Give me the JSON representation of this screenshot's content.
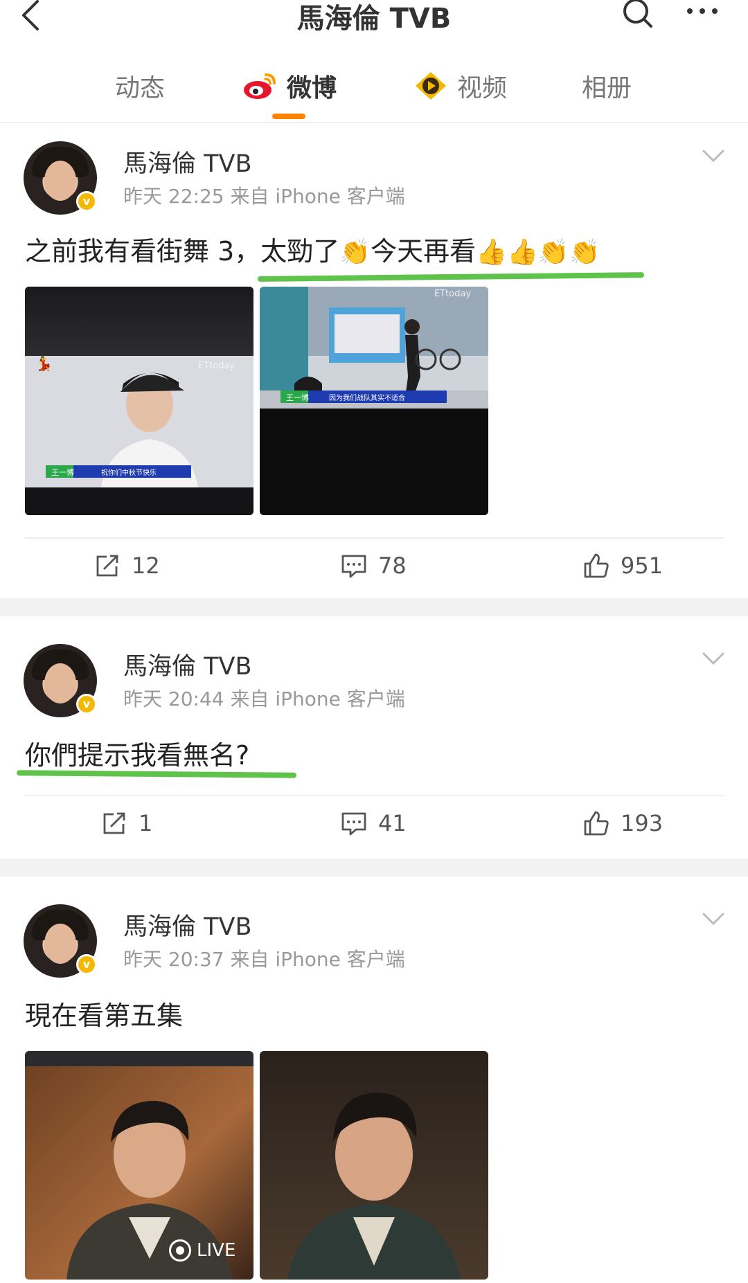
{
  "header": {
    "title": "馬海倫 TVB",
    "back_icon": "chevron-left-icon",
    "search_icon": "search-icon",
    "more_icon": "more-icon"
  },
  "tabs": [
    {
      "label": "动态",
      "icon": null,
      "active": false
    },
    {
      "label": "微博",
      "icon": "weibo-logo-icon",
      "active": true
    },
    {
      "label": "视频",
      "icon": "video-icon",
      "active": false
    },
    {
      "label": "相册",
      "icon": null,
      "active": false
    }
  ],
  "colors": {
    "accent": "#ff8200",
    "highlight_underline": "#5fc24a",
    "verified": "#f5b800",
    "gap": "#f2f2f2"
  },
  "posts": [
    {
      "author": "馬海倫 TVB",
      "meta": "昨天 22:25  来自 iPhone 客户端",
      "text_part1": "之前我有看街舞 3，太勁了",
      "text_part2": "今天再看",
      "emoji_clap": "👏",
      "emoji_thumbs": "👍",
      "reposts": "12",
      "comments": "78",
      "likes": "951",
      "photos": [
        "街舞 screenshot 1",
        "街舞 screenshot 2"
      ],
      "photo_captions": [
        "王一博",
        "祝你们中秋节快乐",
        "王一博",
        "因为我们战队其实不适合"
      ],
      "photo_watermark": "ETtoday"
    },
    {
      "author": "馬海倫 TVB",
      "meta": "昨天 20:44  来自 iPhone 客户端",
      "text": "你們提示我看無名?",
      "reposts": "1",
      "comments": "41",
      "likes": "193"
    },
    {
      "author": "馬海倫 TVB",
      "meta": "昨天 20:37  来自 iPhone 客户端",
      "text": "現在看第五集",
      "live_label": "LIVE"
    }
  ]
}
